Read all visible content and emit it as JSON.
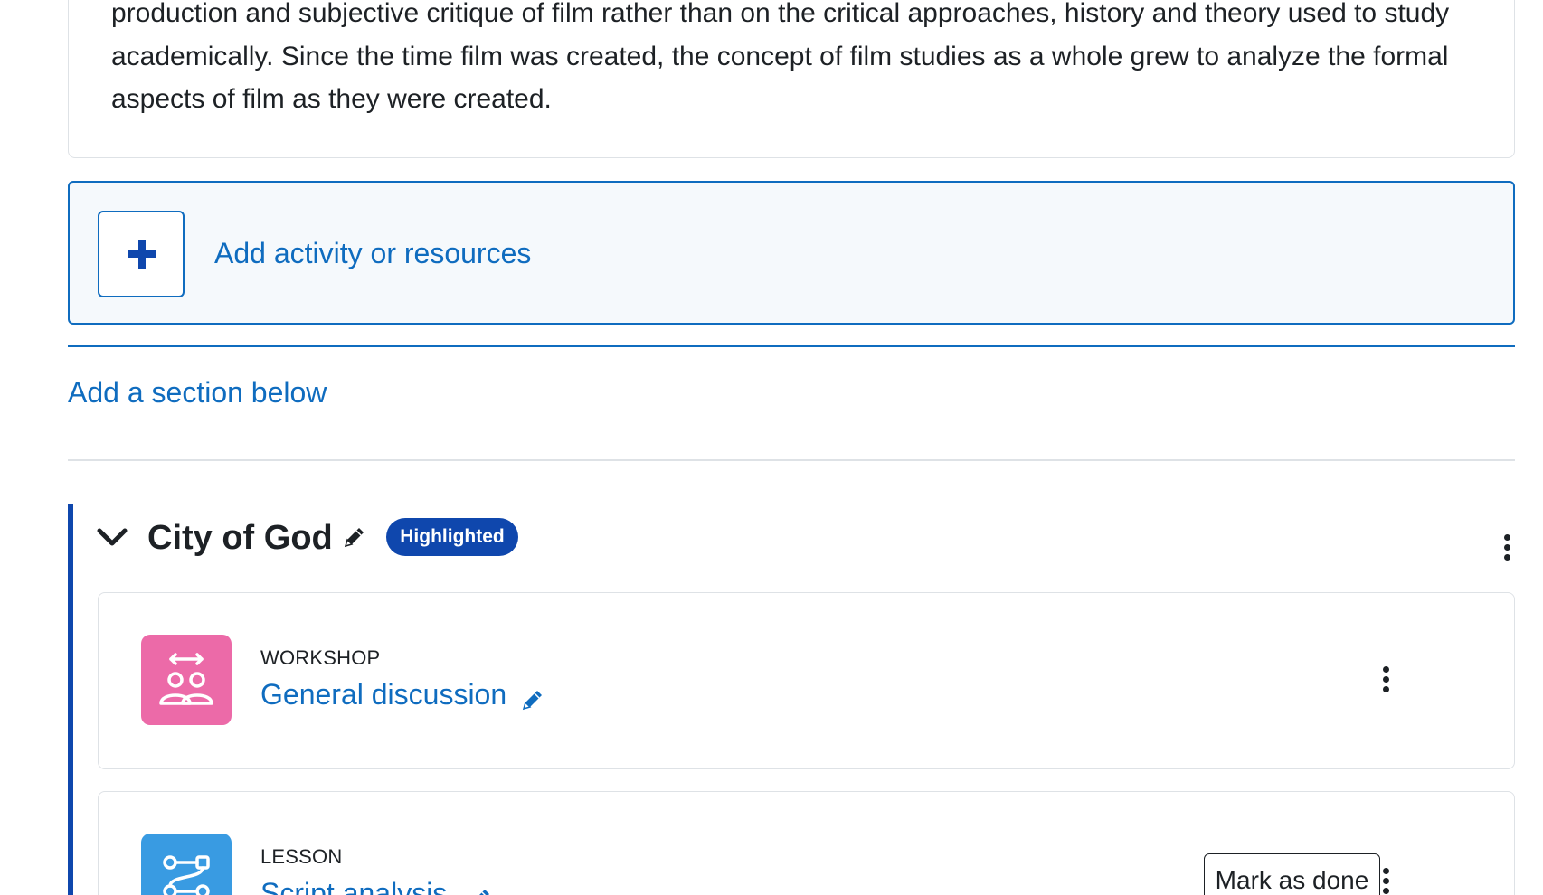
{
  "summary": {
    "text": "production and subjective critique of film rather than on the critical approaches, history and theory used to study academically. Since the time film was created, the concept of film studies as a whole grew to analyze the formal aspects of film as they were created."
  },
  "add_activity": {
    "label": "Add activity or resources",
    "icon": "plus-icon"
  },
  "add_section": {
    "label": "Add a section below"
  },
  "section": {
    "title": "City of God",
    "badge": "Highlighted",
    "accent_color": "#0f47ad",
    "activities": [
      {
        "type": "WORKSHOP",
        "name": "General discussion",
        "icon": "workshop-icon",
        "icon_color": "#ec6aa8"
      },
      {
        "type": "LESSON",
        "name": "Script analysis",
        "icon": "lesson-icon",
        "icon_color": "#399be2",
        "action": "Mark as done"
      }
    ]
  },
  "colors": {
    "link": "#0f6cbf",
    "primary": "#0f47ad",
    "border": "#dee2e6",
    "text": "#1d2125"
  }
}
